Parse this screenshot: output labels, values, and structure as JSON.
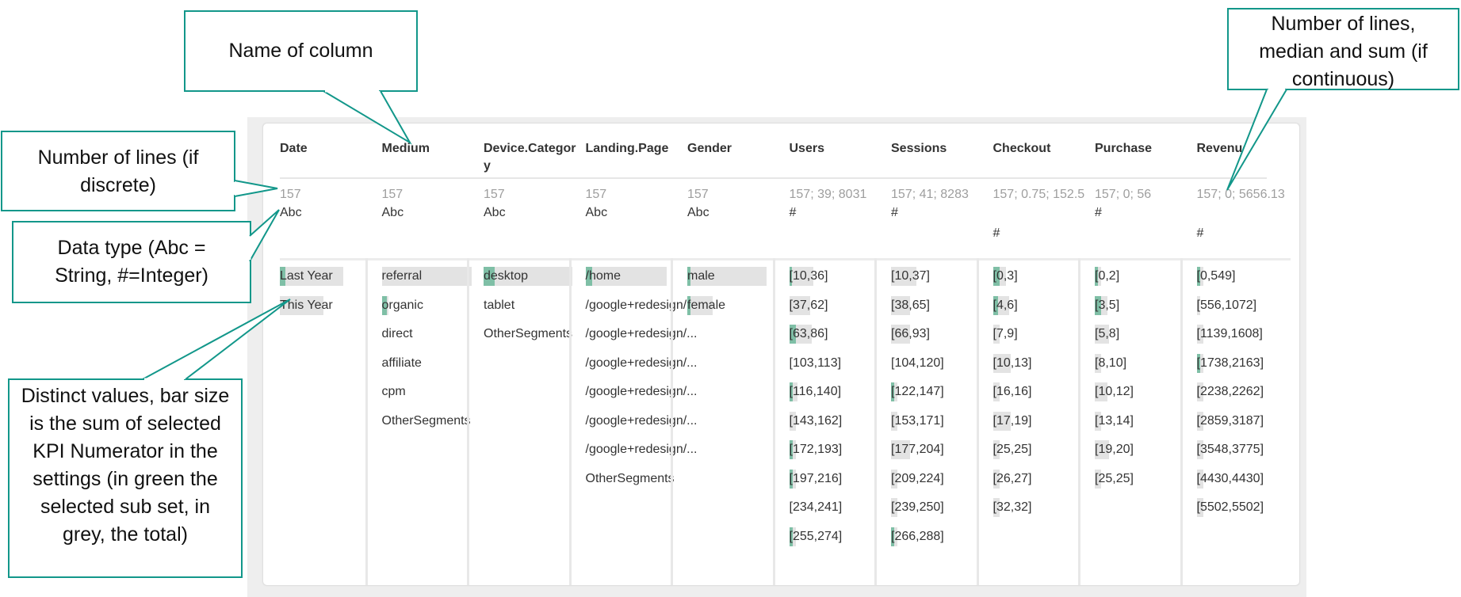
{
  "table": {
    "columns": [
      {
        "header": "Date",
        "stats": "157",
        "dtype": "Abc",
        "items": [
          {
            "label": "Last Year",
            "bg": 80,
            "hl": 7
          },
          {
            "label": "This Year",
            "bg": 55,
            "hl": 0
          }
        ]
      },
      {
        "header": "Medium",
        "stats": "157",
        "dtype": "Abc",
        "items": [
          {
            "label": "referral",
            "bg": 113,
            "hl": 0
          },
          {
            "label": "organic",
            "bg": 8,
            "hl": 6
          },
          {
            "label": "direct",
            "bg": 0,
            "hl": 0
          },
          {
            "label": "affiliate",
            "bg": 0,
            "hl": 0
          },
          {
            "label": "cpm",
            "bg": 0,
            "hl": 0
          },
          {
            "label": "OtherSegments",
            "bg": 0,
            "hl": 0
          }
        ]
      },
      {
        "header": "Device.Category",
        "stats": "157",
        "dtype": "Abc",
        "items": [
          {
            "label": "desktop",
            "bg": 112,
            "hl": 14
          },
          {
            "label": "tablet",
            "bg": 0,
            "hl": 0
          },
          {
            "label": "OtherSegments",
            "bg": 0,
            "hl": 0
          }
        ]
      },
      {
        "header": "Landing.Page",
        "stats": "157",
        "dtype": "Abc",
        "items": [
          {
            "label": "/home",
            "bg": 102,
            "hl": 8
          },
          {
            "label": "/google+redesign/...",
            "bg": 0,
            "hl": 0
          },
          {
            "label": "/google+redesign/...",
            "bg": 0,
            "hl": 0
          },
          {
            "label": "/google+redesign/...",
            "bg": 0,
            "hl": 0
          },
          {
            "label": "/google+redesign/...",
            "bg": 0,
            "hl": 0
          },
          {
            "label": "/google+redesign/...",
            "bg": 0,
            "hl": 0
          },
          {
            "label": "/google+redesign/...",
            "bg": 0,
            "hl": 0
          },
          {
            "label": "OtherSegments",
            "bg": 0,
            "hl": 0
          }
        ]
      },
      {
        "header": "Gender",
        "stats": "157",
        "dtype": "Abc",
        "items": [
          {
            "label": "male",
            "bg": 100,
            "hl": 4
          },
          {
            "label": "female",
            "bg": 32,
            "hl": 4
          }
        ]
      },
      {
        "header": "Users",
        "stats": "157; 39; 8031",
        "dtype": "#",
        "items": [
          {
            "label": "[10,36]",
            "bg": 30,
            "hl": 3
          },
          {
            "label": "[37,62]",
            "bg": 26,
            "hl": 0
          },
          {
            "label": "[63,86]",
            "bg": 28,
            "hl": 8
          },
          {
            "label": "[103,113]",
            "bg": 0,
            "hl": 0
          },
          {
            "label": "[116,140]",
            "bg": 10,
            "hl": 4
          },
          {
            "label": "[143,162]",
            "bg": 8,
            "hl": 0
          },
          {
            "label": "[172,193]",
            "bg": 8,
            "hl": 4
          },
          {
            "label": "[197,216]",
            "bg": 8,
            "hl": 4
          },
          {
            "label": "[234,241]",
            "bg": 0,
            "hl": 0
          },
          {
            "label": "[255,274]",
            "bg": 8,
            "hl": 4
          }
        ]
      },
      {
        "header": "Sessions",
        "stats": "157; 41; 8283",
        "dtype": "#",
        "items": [
          {
            "label": "[10,37]",
            "bg": 32,
            "hl": 0
          },
          {
            "label": "[38,65]",
            "bg": 24,
            "hl": 0
          },
          {
            "label": "[66,93]",
            "bg": 24,
            "hl": 0
          },
          {
            "label": "[104,120]",
            "bg": 0,
            "hl": 0
          },
          {
            "label": "[122,147]",
            "bg": 8,
            "hl": 4
          },
          {
            "label": "[153,171]",
            "bg": 8,
            "hl": 0
          },
          {
            "label": "[177,204]",
            "bg": 24,
            "hl": 0
          },
          {
            "label": "[209,224]",
            "bg": 8,
            "hl": 0
          },
          {
            "label": "[239,250]",
            "bg": 8,
            "hl": 0
          },
          {
            "label": "[266,288]",
            "bg": 8,
            "hl": 4
          }
        ]
      },
      {
        "header": "Checkout",
        "stats": "157; 0.75; 152.5",
        "dtype": "#",
        "items": [
          {
            "label": "[0,3]",
            "bg": 16,
            "hl": 8
          },
          {
            "label": "[4,6]",
            "bg": 20,
            "hl": 6
          },
          {
            "label": "[7,9]",
            "bg": 8,
            "hl": 0
          },
          {
            "label": "[10,13]",
            "bg": 22,
            "hl": 0
          },
          {
            "label": "[16,16]",
            "bg": 8,
            "hl": 0
          },
          {
            "label": "[17,19]",
            "bg": 22,
            "hl": 0
          },
          {
            "label": "[25,25]",
            "bg": 8,
            "hl": 0
          },
          {
            "label": "[26,27]",
            "bg": 8,
            "hl": 0
          },
          {
            "label": "[32,32]",
            "bg": 8,
            "hl": 0
          }
        ]
      },
      {
        "header": "Purchase",
        "stats": "157; 0; 56",
        "dtype": "#",
        "items": [
          {
            "label": "[0,2]",
            "bg": 8,
            "hl": 4
          },
          {
            "label": "[3,5]",
            "bg": 16,
            "hl": 8
          },
          {
            "label": "[5,8]",
            "bg": 18,
            "hl": 0
          },
          {
            "label": "[8,10]",
            "bg": 8,
            "hl": 0
          },
          {
            "label": "[10,12]",
            "bg": 16,
            "hl": 0
          },
          {
            "label": "[13,14]",
            "bg": 8,
            "hl": 0
          },
          {
            "label": "[19,20]",
            "bg": 18,
            "hl": 0
          },
          {
            "label": "[25,25]",
            "bg": 8,
            "hl": 0
          }
        ]
      },
      {
        "header": "Revenue",
        "stats": "157; 0; 5656.13",
        "dtype": "#",
        "items": [
          {
            "label": "[0,549]",
            "bg": 8,
            "hl": 4
          },
          {
            "label": "[556,1072]",
            "bg": 4,
            "hl": 0
          },
          {
            "label": "[1139,1608]",
            "bg": 8,
            "hl": 0
          },
          {
            "label": "[1738,2163]",
            "bg": 8,
            "hl": 4
          },
          {
            "label": "[2238,2262]",
            "bg": 8,
            "hl": 0
          },
          {
            "label": "[2859,3187]",
            "bg": 8,
            "hl": 0
          },
          {
            "label": "[3548,3775]",
            "bg": 8,
            "hl": 0
          },
          {
            "label": "[4430,4430]",
            "bg": 8,
            "hl": 0
          },
          {
            "label": "[5502,5502]",
            "bg": 8,
            "hl": 0
          }
        ]
      }
    ]
  },
  "callouts": {
    "name_of_column": "Name of column",
    "lines_median_sum": "Number of lines, median and sum (if continuous)",
    "lines_discrete": "Number of lines (if discrete)",
    "data_type": "Data type (Abc = String, #=Integer)",
    "distinct_values": "Distinct values, bar size is the sum of selected KPI Numerator in the settings (in green the selected sub set, in grey, the total)"
  },
  "colors": {
    "accent": "#12978a",
    "selected": "#7fbfa6",
    "total": "#e3e3e3"
  }
}
